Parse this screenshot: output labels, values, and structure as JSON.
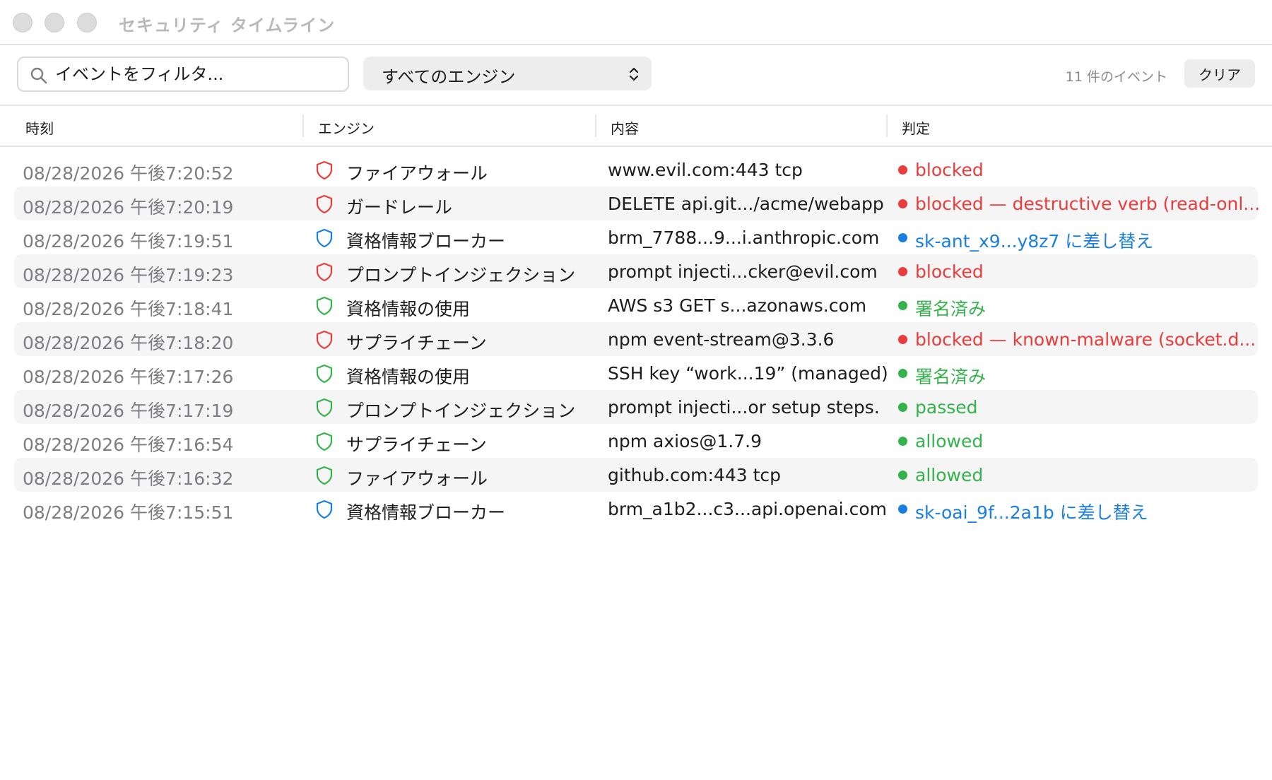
{
  "window": {
    "title": "セキュリティ タイムライン"
  },
  "toolbar": {
    "search_placeholder": "イベントをフィルタ...",
    "engine_filter_value": "すべてのエンジン",
    "event_count": "11 件のイベント",
    "clear_label": "クリア"
  },
  "table": {
    "headers": {
      "time": "時刻",
      "engine": "エンジン",
      "content": "内容",
      "verdict": "判定"
    },
    "rows": [
      {
        "time": "08/28/2026 午後7:20:52",
        "engine": "ファイアウォール",
        "content": "www.evil.com:443 tcp",
        "verdict": "blocked",
        "status": "red"
      },
      {
        "time": "08/28/2026 午後7:20:19",
        "engine": "ガードレール",
        "content": "DELETE api.git.../acme/webapp",
        "verdict": "blocked — destructive verb (read-onl...",
        "status": "red"
      },
      {
        "time": "08/28/2026 午後7:19:51",
        "engine": "資格情報ブローカー",
        "content": "brm_7788...9...i.anthropic.com",
        "verdict": "sk-ant_x9...y8z7 に差し替え",
        "status": "blue"
      },
      {
        "time": "08/28/2026 午後7:19:23",
        "engine": "プロンプトインジェクション",
        "content": "prompt injecti...cker@evil.com",
        "verdict": "blocked",
        "status": "red"
      },
      {
        "time": "08/28/2026 午後7:18:41",
        "engine": "資格情報の使用",
        "content": "AWS s3 GET s...azonaws.com",
        "verdict": "署名済み",
        "status": "green"
      },
      {
        "time": "08/28/2026 午後7:18:20",
        "engine": "サプライチェーン",
        "content": "npm event-stream@3.3.6",
        "verdict": "blocked — known-malware (socket.d...",
        "status": "red"
      },
      {
        "time": "08/28/2026 午後7:17:26",
        "engine": "資格情報の使用",
        "content": "SSH key “work...19” (managed)",
        "verdict": "署名済み",
        "status": "green"
      },
      {
        "time": "08/28/2026 午後7:17:19",
        "engine": "プロンプトインジェクション",
        "content": "prompt injecti...or setup steps.",
        "verdict": "passed",
        "status": "green"
      },
      {
        "time": "08/28/2026 午後7:16:54",
        "engine": "サプライチェーン",
        "content": "npm axios@1.7.9",
        "verdict": "allowed",
        "status": "green"
      },
      {
        "time": "08/28/2026 午後7:16:32",
        "engine": "ファイアウォール",
        "content": "github.com:443 tcp",
        "verdict": "allowed",
        "status": "green"
      },
      {
        "time": "08/28/2026 午後7:15:51",
        "engine": "資格情報ブローカー",
        "content": "brm_a1b2...c3...api.openai.com",
        "verdict": "sk-oai_9f...2a1b に差し替え",
        "status": "blue"
      }
    ]
  },
  "colors": {
    "red": "#ec3b3b",
    "blue": "#1a7fe0",
    "green": "#34b24c"
  },
  "icons": {
    "row_icon": "shield-icon",
    "search": "search-icon",
    "select": "chevron-updown-icon"
  }
}
